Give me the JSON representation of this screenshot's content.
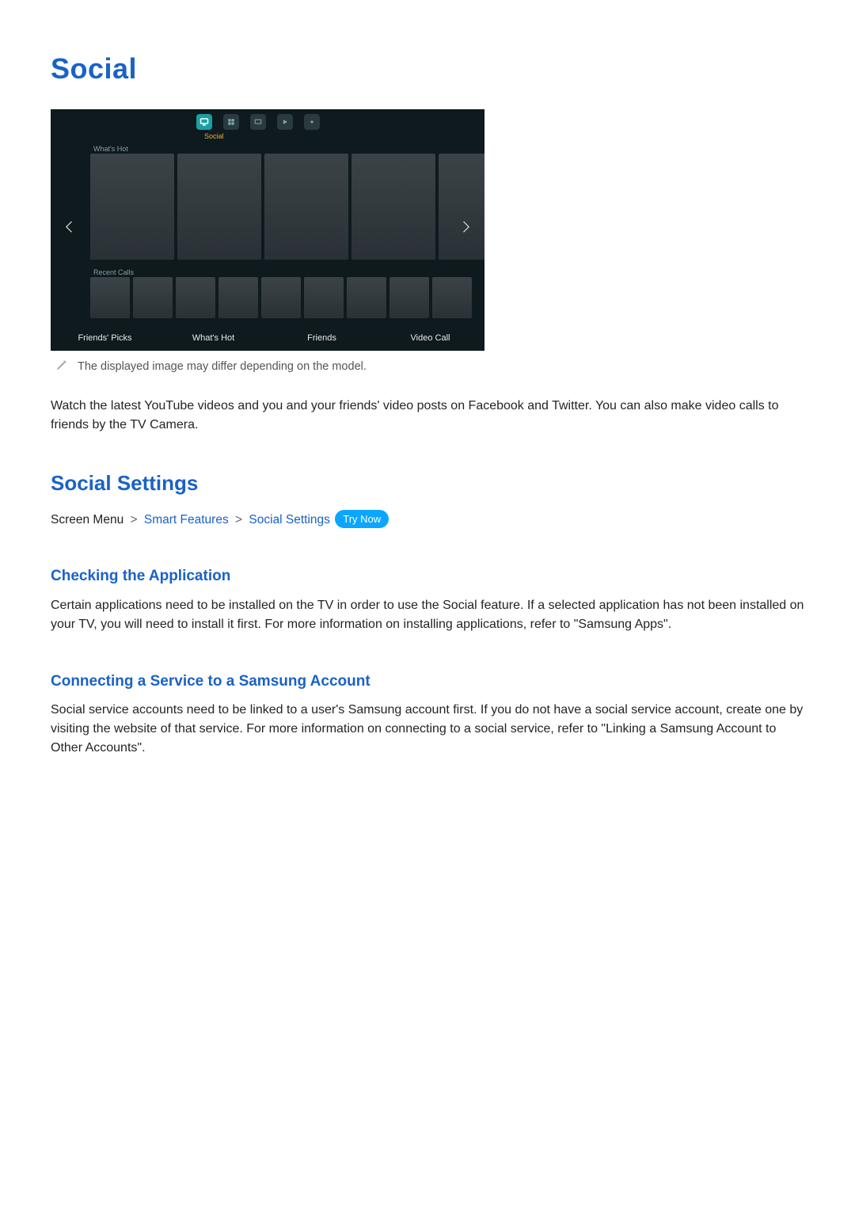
{
  "page_title": "Social",
  "tv": {
    "nav_active_label": "Social",
    "whats_hot_label": "What's Hot",
    "recent_calls_label": "Recent Calls",
    "tabs": [
      "Friends' Picks",
      "What's Hot",
      "Friends",
      "Video Call"
    ]
  },
  "note": "The displayed image may differ depending on the model.",
  "intro": "Watch the latest YouTube videos and you and your friends' video posts on Facebook and Twitter. You can also make video calls to friends by the TV Camera.",
  "social_settings": {
    "heading": "Social Settings",
    "breadcrumb": {
      "root": "Screen Menu",
      "link1": "Smart Features",
      "link2": "Social Settings",
      "try_now": "Try Now"
    }
  },
  "checking_app": {
    "heading": "Checking the Application",
    "text": "Certain applications need to be installed on the TV in order to use the Social feature. If a selected application has not been installed on your TV, you will need to install it first. For more information on installing applications, refer to \"Samsung Apps\"."
  },
  "connecting": {
    "heading": "Connecting a Service to a Samsung Account",
    "text": "Social service accounts need to be linked to a user's Samsung account first. If you do not have a social service account, create one by visiting the website of that service. For more information on connecting to a social service, refer to \"Linking a Samsung Account to Other Accounts\"."
  }
}
